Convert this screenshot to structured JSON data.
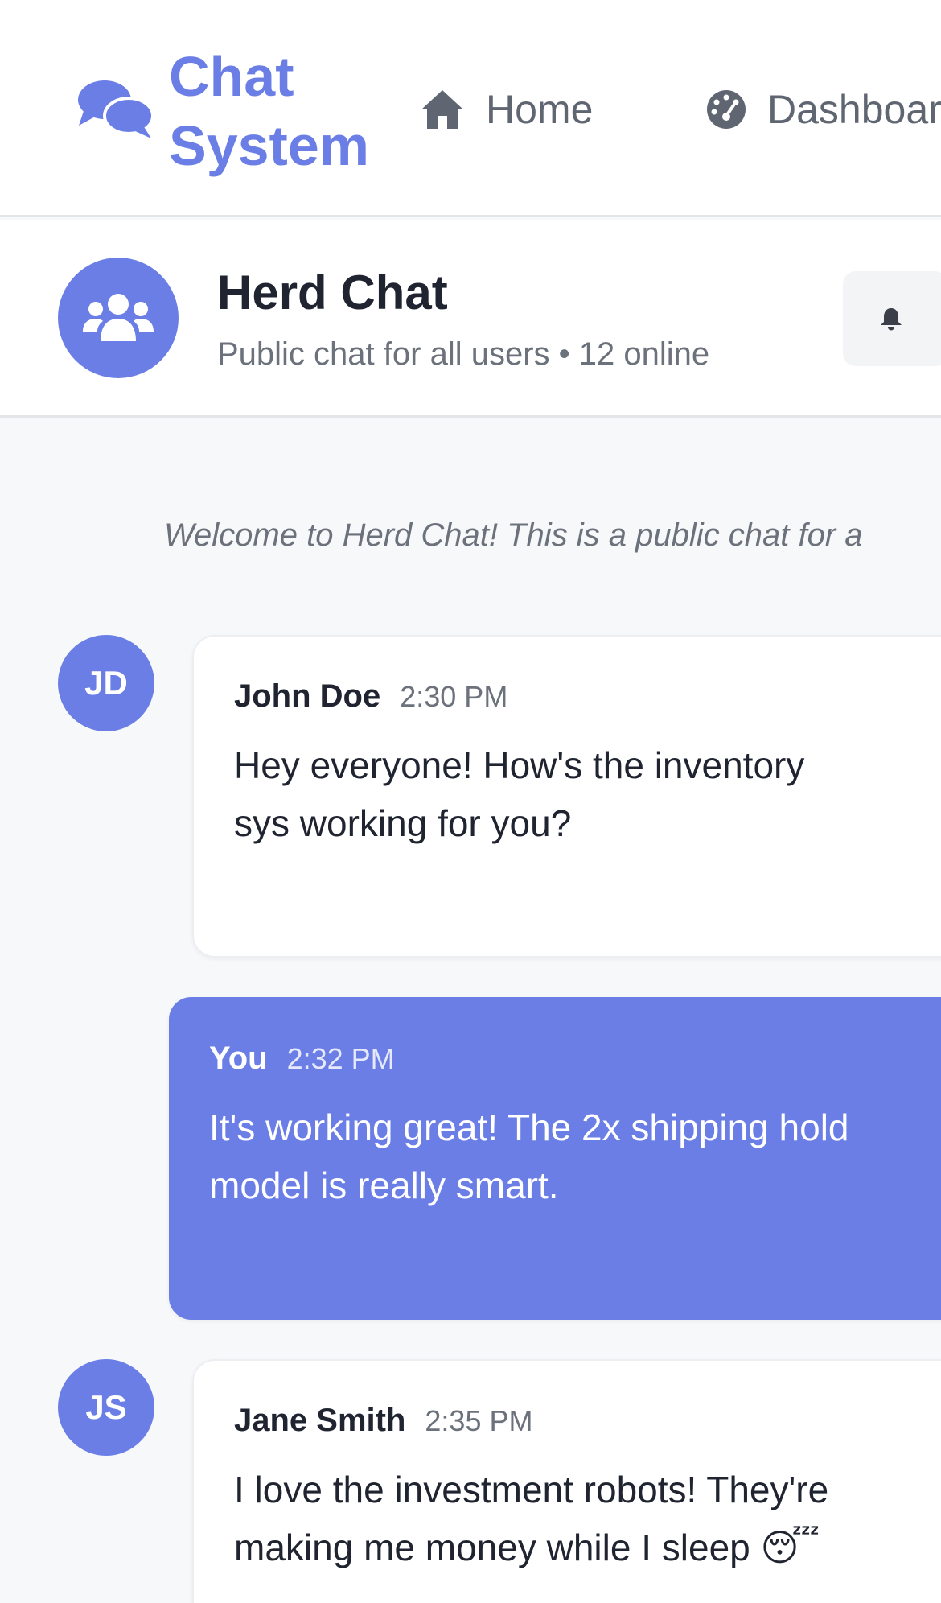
{
  "navbar": {
    "brand_line1": "Chat",
    "brand_line2": "System",
    "brand_icon": "comments-icon",
    "links": [
      {
        "label": "Home",
        "icon": "home-icon"
      },
      {
        "label": "Dashboar",
        "icon": "dashboard-gauge-icon"
      }
    ]
  },
  "chat": {
    "title": "Herd Chat",
    "subtitle": "Public chat for all users • 12 online",
    "avatar_icon": "users-icon",
    "notification_icon": "bell-icon"
  },
  "welcome_text": "Welcome to Herd Chat! This is a public chat for a",
  "messages": [
    {
      "initials": "JD",
      "sender": "John Doe",
      "time": "2:30 PM",
      "text": "Hey everyone! How's the inventory sys working for you?",
      "mine": false
    },
    {
      "initials": "",
      "sender": "You",
      "time": "2:32 PM",
      "text": "It's working great! The 2x shipping hold model is really smart.",
      "mine": true
    },
    {
      "initials": "JS",
      "sender": "Jane Smith",
      "time": "2:35 PM",
      "text": "I love the investment robots! They're making me money while I sleep 😴",
      "mine": false
    }
  ],
  "colors": {
    "accent": "#6a7ee6",
    "text": "#1f2430",
    "muted": "#6c727c",
    "background": "#f7f8fa"
  }
}
